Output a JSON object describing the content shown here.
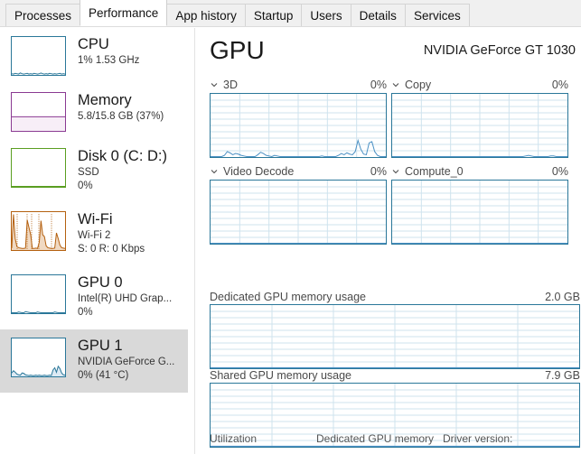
{
  "window": {
    "tabs": [
      {
        "label": "Processes",
        "active": false
      },
      {
        "label": "Performance",
        "active": true
      },
      {
        "label": "App history",
        "active": false
      },
      {
        "label": "Startup",
        "active": false
      },
      {
        "label": "Users",
        "active": false
      },
      {
        "label": "Details",
        "active": false
      },
      {
        "label": "Services",
        "active": false
      }
    ]
  },
  "sidebar": {
    "items": [
      {
        "name": "CPU",
        "line2": "1%  1.53 GHz",
        "line3": "",
        "color": "#2a7799",
        "selected": false
      },
      {
        "name": "Memory",
        "line2": "5.8/15.8 GB (37%)",
        "line3": "",
        "color": "#8a3a92",
        "selected": false
      },
      {
        "name": "Disk 0 (C: D:)",
        "line2": "SSD",
        "line3": "0%",
        "color": "#5a9e21",
        "selected": false
      },
      {
        "name": "Wi-Fi",
        "line2": "Wi-Fi 2",
        "line3": "S: 0 R: 0 Kbps",
        "color": "#b4600f",
        "selected": false
      },
      {
        "name": "GPU 0",
        "line2": "Intel(R) UHD Grap...",
        "line3": "0%",
        "color": "#2a7799",
        "selected": false
      },
      {
        "name": "GPU 1",
        "line2": "NVIDIA GeForce G...",
        "line3": "0%  (41 °C)",
        "color": "#2a7799",
        "selected": true
      }
    ]
  },
  "main": {
    "title": "GPU",
    "device": "NVIDIA GeForce GT 1030",
    "engines": [
      {
        "label": "3D",
        "value": "0%"
      },
      {
        "label": "Copy",
        "value": "0%"
      },
      {
        "label": "Video Decode",
        "value": "0%"
      },
      {
        "label": "Compute_0",
        "value": "0%"
      }
    ],
    "memory_graphs": [
      {
        "label": "Dedicated GPU memory usage",
        "value": "2.0 GB"
      },
      {
        "label": "Shared GPU memory usage",
        "value": "7.9 GB"
      }
    ],
    "footer": [
      {
        "label": "Utilization"
      },
      {
        "label": "Dedicated GPU memory"
      },
      {
        "label": "Driver version:"
      }
    ],
    "colors": {
      "graph_border": "#2a7799",
      "graph_line": "#4a90c4",
      "grid": "#cfe3ee",
      "selected_bg": "#d9d9d9"
    }
  },
  "chart_data": [
    {
      "type": "line",
      "title": "3D",
      "ylabel": "Utilization",
      "ylim": [
        0,
        100
      ],
      "grid": true,
      "values": [
        0,
        0,
        0,
        0,
        0,
        2,
        8,
        6,
        3,
        5,
        4,
        2,
        1,
        0,
        0,
        0,
        0,
        3,
        7,
        5,
        2,
        1,
        0,
        2,
        1,
        0,
        0,
        0,
        0,
        0,
        0,
        0,
        0,
        0,
        0,
        0,
        0,
        0,
        0,
        0,
        1,
        0,
        0,
        0,
        0,
        0,
        2,
        5,
        3,
        6,
        4,
        3,
        8,
        26,
        12,
        4,
        3,
        22,
        24,
        8,
        2,
        0,
        0,
        0
      ]
    },
    {
      "type": "line",
      "title": "Copy",
      "ylim": [
        0,
        100
      ],
      "grid": true,
      "values": [
        0,
        0,
        0,
        0,
        0,
        0,
        0,
        0,
        0,
        0,
        0,
        0,
        0,
        0,
        0,
        0,
        0,
        0,
        0,
        0,
        0,
        0,
        0,
        0,
        0,
        0,
        0,
        0,
        0,
        0,
        0,
        0,
        0,
        0,
        0,
        0,
        0,
        0,
        0,
        0,
        0,
        0,
        0,
        0,
        0,
        0,
        0,
        0,
        1,
        2,
        1,
        0,
        0,
        0,
        0,
        0,
        0,
        1,
        1,
        0,
        0,
        0,
        0,
        0
      ]
    },
    {
      "type": "line",
      "title": "Video Decode",
      "ylim": [
        0,
        100
      ],
      "grid": true,
      "values": [
        0,
        0,
        0,
        0,
        0,
        0,
        0,
        0,
        0,
        0,
        0,
        0,
        0,
        0,
        0,
        0,
        0,
        0,
        0,
        0,
        0,
        0,
        0,
        0,
        0,
        0,
        0,
        0,
        0,
        0,
        0,
        0,
        0,
        0,
        0,
        0,
        0,
        0,
        0,
        0,
        0,
        0,
        0,
        0,
        0,
        0,
        0,
        0,
        0,
        0,
        0,
        0,
        0,
        0,
        0,
        0,
        0,
        0,
        0,
        0,
        0,
        0,
        0,
        0
      ]
    },
    {
      "type": "line",
      "title": "Compute_0",
      "ylim": [
        0,
        100
      ],
      "grid": true,
      "values": [
        0,
        0,
        0,
        0,
        0,
        0,
        0,
        0,
        0,
        0,
        0,
        0,
        0,
        0,
        0,
        0,
        0,
        0,
        0,
        0,
        0,
        0,
        0,
        0,
        0,
        0,
        0,
        0,
        0,
        0,
        0,
        0,
        0,
        0,
        0,
        0,
        0,
        0,
        0,
        0,
        0,
        0,
        0,
        0,
        0,
        0,
        0,
        0,
        0,
        0,
        0,
        0,
        0,
        0,
        0,
        0,
        0,
        0,
        0,
        0,
        0,
        0,
        0,
        0
      ]
    },
    {
      "type": "area",
      "title": "Dedicated GPU memory usage",
      "ylim": [
        0,
        2.0
      ],
      "ylabel": "GB",
      "grid": true,
      "values": [
        0,
        0,
        0,
        0,
        0,
        0,
        0,
        0,
        0,
        0,
        0,
        0,
        0,
        0,
        0,
        0,
        0,
        0,
        0,
        0,
        0,
        0,
        0,
        0,
        0,
        0,
        0,
        0,
        0,
        0,
        0,
        0
      ]
    },
    {
      "type": "area",
      "title": "Shared GPU memory usage",
      "ylim": [
        0,
        7.9
      ],
      "ylabel": "GB",
      "grid": true,
      "values": [
        0,
        0,
        0,
        0,
        0,
        0,
        0,
        0,
        0,
        0,
        0,
        0,
        0,
        0,
        0,
        0,
        0,
        0,
        0,
        0,
        0,
        0,
        0,
        0,
        0,
        0,
        0,
        0,
        0,
        0,
        0,
        0
      ]
    },
    {
      "type": "line",
      "title": "CPU thumbnail",
      "ylim": [
        0,
        100
      ],
      "grid": false,
      "values": [
        2,
        1,
        3,
        2,
        1,
        4,
        2,
        1,
        2,
        3,
        1,
        2,
        1,
        3,
        2,
        1,
        2,
        4,
        2,
        1,
        2,
        1,
        3,
        2,
        1,
        2,
        1,
        2,
        3,
        1,
        2,
        1
      ]
    },
    {
      "type": "area",
      "title": "Memory thumbnail",
      "ylim": [
        0,
        100
      ],
      "grid": false,
      "values": [
        37,
        37,
        37,
        37,
        37,
        37,
        37,
        37,
        37,
        37,
        37,
        37,
        37,
        37,
        37,
        37,
        37,
        37,
        37,
        37,
        37,
        37,
        37,
        37,
        37,
        37,
        37,
        37,
        37,
        37,
        37,
        37
      ]
    },
    {
      "type": "line",
      "title": "Disk 0 thumbnail",
      "ylim": [
        0,
        100
      ],
      "grid": false,
      "values": [
        0,
        0,
        0,
        0,
        0,
        0,
        0,
        0,
        0,
        0,
        0,
        0,
        0,
        0,
        0,
        0,
        0,
        0,
        0,
        0,
        0,
        0,
        0,
        0,
        0,
        0,
        0,
        0,
        0,
        0,
        0,
        0
      ]
    },
    {
      "type": "area",
      "title": "Wi-Fi thumbnail",
      "ylim": [
        0,
        100
      ],
      "grid": false,
      "values": [
        4,
        95,
        30,
        8,
        5,
        4,
        3,
        3,
        4,
        80,
        60,
        40,
        3,
        3,
        4,
        3,
        20,
        78,
        40,
        35,
        10,
        5,
        4,
        3,
        3,
        4,
        45,
        30,
        12,
        5,
        4,
        3
      ]
    },
    {
      "type": "line",
      "title": "GPU 0 thumbnail",
      "ylim": [
        0,
        100
      ],
      "grid": false,
      "values": [
        0,
        0,
        0,
        0,
        2,
        1,
        0,
        0,
        3,
        2,
        1,
        0,
        0,
        0,
        0,
        2,
        1,
        0,
        0,
        0,
        0,
        0,
        0,
        0,
        0,
        2,
        1,
        0,
        0,
        0,
        0,
        0
      ]
    },
    {
      "type": "area",
      "title": "GPU 1 thumbnail",
      "ylim": [
        0,
        100
      ],
      "grid": false,
      "values": [
        8,
        14,
        10,
        5,
        3,
        2,
        8,
        7,
        3,
        2,
        1,
        2,
        1,
        1,
        2,
        1,
        2,
        1,
        1,
        2,
        1,
        1,
        2,
        1,
        16,
        22,
        10,
        26,
        20,
        8,
        3,
        2
      ]
    }
  ]
}
